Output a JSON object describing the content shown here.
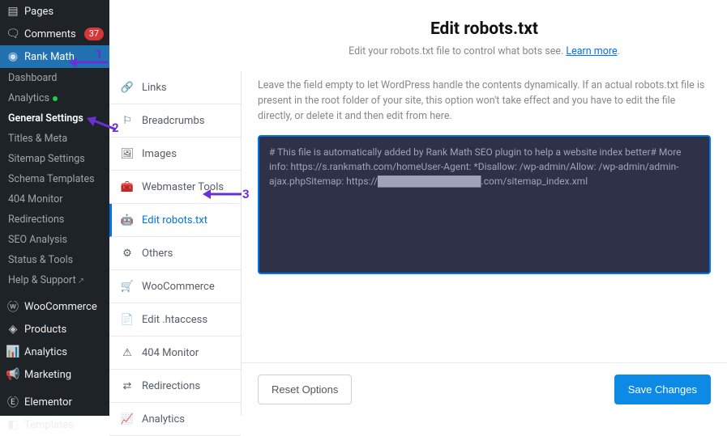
{
  "wp_menu": {
    "pages": "Pages",
    "comments": "Comments",
    "comments_badge": "37",
    "rankmath": "Rank Math",
    "sub": {
      "dashboard": "Dashboard",
      "analytics": "Analytics",
      "general_settings": "General Settings",
      "titles_meta": "Titles & Meta",
      "sitemap": "Sitemap Settings",
      "schema": "Schema Templates",
      "monitor404": "404 Monitor",
      "redirections": "Redirections",
      "seo_analysis": "SEO Analysis",
      "status": "Status & Tools",
      "help": "Help & Support"
    },
    "woocommerce": "WooCommerce",
    "products": "Products",
    "analytics2": "Analytics",
    "marketing": "Marketing",
    "elementor": "Elementor",
    "templates": "Templates"
  },
  "settings_menu": {
    "links": "Links",
    "breadcrumbs": "Breadcrumbs",
    "images": "Images",
    "webmaster": "Webmaster Tools",
    "edit_robots": "Edit robots.txt",
    "others": "Others",
    "woocommerce": "WooCommerce",
    "htaccess": "Edit .htaccess",
    "monitor404": "404 Monitor",
    "redirections": "Redirections",
    "analytics": "Analytics"
  },
  "main": {
    "title": "Edit robots.txt",
    "subtitle_pre": "Edit your robots.txt file to control what bots see. ",
    "learn_more": "Learn more",
    "help_text": "Leave the field empty to let WordPress handle the contents dynamically. If an actual robots.txt file is present in the root folder of your site, this option won't take effect and you have to edit the file directly, or delete it and then edit from here.",
    "editor_text": "# This file is automatically added by Rank Math SEO plugin to help a website index better# More info: https://s.rankmath.com/homeUser-Agent: *Disallow: /wp-admin/Allow: /wp-admin/admin-ajax.phpSitemap: https://███████████████.com/sitemap_index.xml",
    "reset": "Reset Options",
    "save": "Save Changes"
  },
  "annotations": {
    "a1": "1",
    "a2": "2",
    "a3": "3"
  }
}
